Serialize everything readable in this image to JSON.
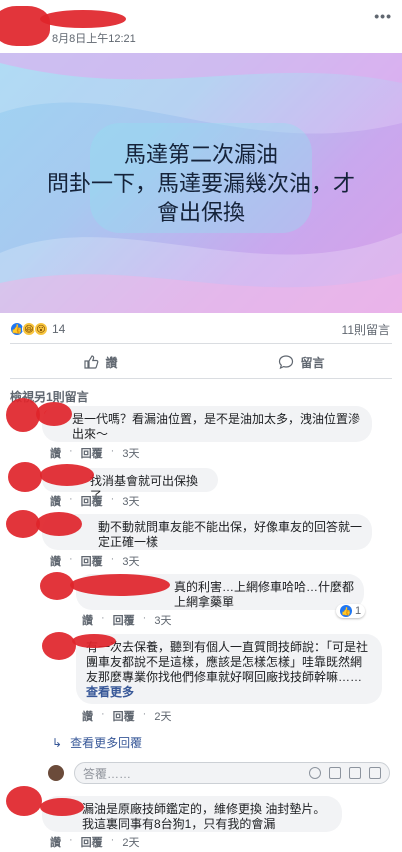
{
  "post": {
    "time": "8月8日上午12:21",
    "more": "•••",
    "image_text": [
      "馬達第二次漏油",
      "問卦一下，馬達要漏幾次油，才",
      "會出保換"
    ],
    "reaction_count": "14",
    "comment_count": "11則留言",
    "like_label": "讚",
    "comment_label": "留言"
  },
  "view_previous": "檢視另1則留言",
  "comments": [
    {
      "text": "是一代嗎？看漏油位置，是不是油加太多，洩油位置滲出來～",
      "like": "讚",
      "reply": "回覆",
      "time": "3天"
    },
    {
      "text": "找消基會就可出保換了",
      "like": "讚",
      "reply": "回覆",
      "time": "3天"
    },
    {
      "text": "動不動就問車友能不能出保，好像車友的回答就一定正確一樣",
      "like": "讚",
      "reply": "回覆",
      "time": "3天"
    }
  ],
  "replies": [
    {
      "text": "真的利害…上網修車哈哈…什麼都上網拿藥單",
      "like": "讚",
      "reply": "回覆",
      "time": "3天",
      "reaction_count": "1"
    },
    {
      "text": "有一次去保養，聽到有個人一直質問技師說：「可是社團車友都說不是這樣，應該是怎樣怎樣」哇靠既然網友那麼專業你找他們修車就好啊回廠找技師幹嘛……",
      "see_more": "查看更多",
      "like": "讚",
      "reply": "回覆",
      "time": "2天"
    }
  ],
  "more_replies": "查看更多回覆",
  "reply_placeholder": "答覆……",
  "last_comment": {
    "text": "漏油是原廠技師鑑定的，維修更換 油封墊片。我這裏同事有8台狗1，只有我的會漏",
    "like": "讚",
    "reply": "回覆",
    "time": "2天"
  }
}
